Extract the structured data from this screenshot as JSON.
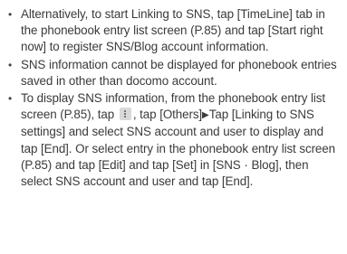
{
  "notes": {
    "bullet": "•",
    "item1": "Alternatively, to start Linking to SNS, tap [TimeLine] tab in the phonebook entry list screen (P.85) and tap [Start right now] to register SNS/Blog account information.",
    "item2": "SNS information cannot be displayed for phonebook entries saved in other than docomo account.",
    "item3": {
      "part1": "To display SNS information, from the phonebook entry list screen (P.85), tap",
      "menu_icon": "menu-key-icon",
      "part2": ", tap [Others]",
      "arrow": "▶",
      "part3": "Tap [Linking to SNS settings] and select SNS account and user to display and tap [End]. Or select entry in the phonebook entry list screen (P.85) and tap [Edit] and tap [Set] in [SNS · Blog], then select SNS account and user and tap [End]."
    }
  }
}
